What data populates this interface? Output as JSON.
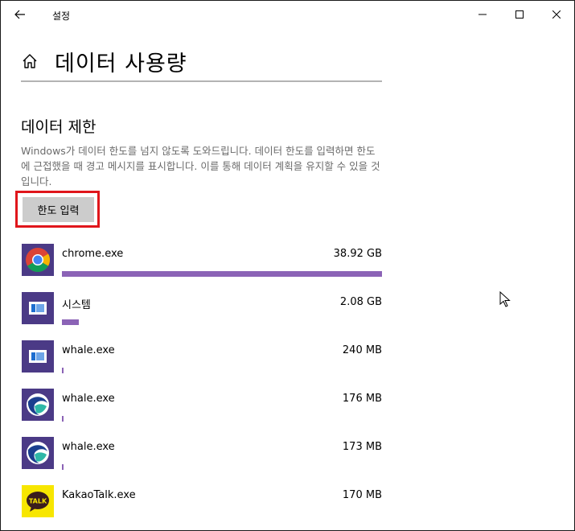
{
  "window": {
    "title": "설정",
    "controls": {
      "minimize": "minimize",
      "maximize": "maximize",
      "close": "close"
    }
  },
  "page": {
    "title": "데이터 사용량"
  },
  "data_limit": {
    "heading": "데이터 제한",
    "description": "Windows가 데이터 한도를 넘지 않도록 도와드립니다. 데이터 한도를 입력하면 한도에 근접했을 때 경고 메시지를 표시합니다. 이를 통해 데이터 계획을 유지할 수 있을 것입니다.",
    "button_label": "한도 입력"
  },
  "apps": [
    {
      "name": "chrome.exe",
      "size": "38.92 GB",
      "usage_fraction": 1.0,
      "icon": "chrome-icon"
    },
    {
      "name": "시스템",
      "size": "2.08 GB",
      "usage_fraction": 0.053,
      "icon": "system-icon"
    },
    {
      "name": "whale.exe",
      "size": "240 MB",
      "usage_fraction": 0.006,
      "icon": "system-icon"
    },
    {
      "name": "whale.exe",
      "size": "176 MB",
      "usage_fraction": 0.0045,
      "icon": "whale-icon"
    },
    {
      "name": "whale.exe",
      "size": "173 MB",
      "usage_fraction": 0.0044,
      "icon": "whale-icon"
    },
    {
      "name": "KakaoTalk.exe",
      "size": "170 MB",
      "usage_fraction": 0.0044,
      "icon": "kakaotalk-icon"
    }
  ],
  "colors": {
    "accent_bar": "#8b63b6",
    "icon_tile": "#4b3a86",
    "highlight": "#e0161b",
    "button_bg": "#cccccc"
  }
}
